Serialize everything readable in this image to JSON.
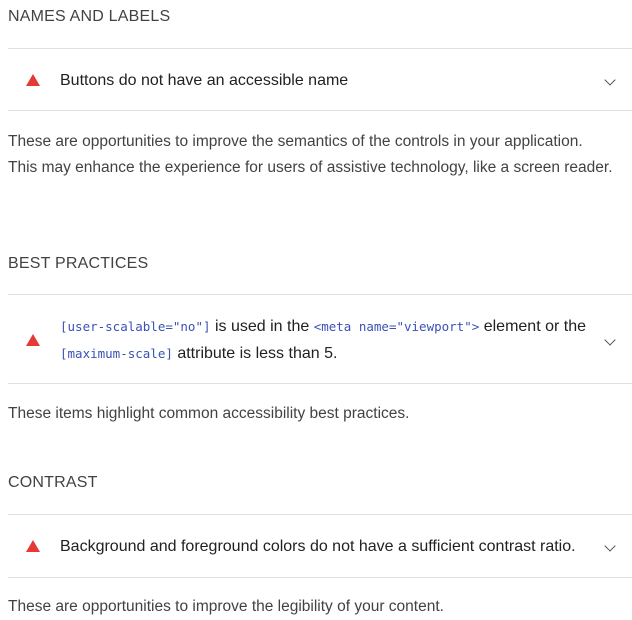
{
  "sections": [
    {
      "heading": "NAMES AND LABELS",
      "audit_title": "Buttons do not have an accessible name",
      "description": "These are opportunities to improve the semantics of the controls in your application. This may enhance the experience for users of assistive technology, like a screen reader."
    },
    {
      "heading": "BEST PRACTICES",
      "audit_parts": {
        "code1": "[user-scalable=\"no\"]",
        "text1": " is used in the ",
        "code2": "<meta name=\"viewport\">",
        "text2": " element or the ",
        "code3": "[maximum-scale]",
        "text3": " attribute is less than 5."
      },
      "description": "These items highlight common accessibility best practices."
    },
    {
      "heading": "CONTRAST",
      "audit_title": "Background and foreground colors do not have a sufficient contrast ratio.",
      "description": "These are opportunities to improve the legibility of your content."
    }
  ],
  "colors": {
    "warning": "#e53935",
    "code": "#3b52b5",
    "divider": "#e0e0e0"
  },
  "icons": {
    "warning": "warning-triangle-icon",
    "expand": "chevron-down-icon"
  }
}
